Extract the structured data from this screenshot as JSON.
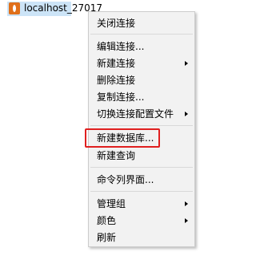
{
  "tree": {
    "connection_label": "localhost_27017",
    "icon": "mongodb-leaf-icon"
  },
  "menu": {
    "items": [
      {
        "label": "关闭连接",
        "submenu": false
      },
      {
        "label": "编辑连接...",
        "submenu": false
      },
      {
        "label": "新建连接",
        "submenu": true
      },
      {
        "label": "删除连接",
        "submenu": false
      },
      {
        "label": "复制连接...",
        "submenu": false
      },
      {
        "label": "切换连接配置文件",
        "submenu": true
      },
      {
        "label": "新建数据库...",
        "submenu": false,
        "highlighted": true
      },
      {
        "label": "新建查询",
        "submenu": false
      },
      {
        "label": "命令列界面...",
        "submenu": false
      },
      {
        "label": "管理组",
        "submenu": true
      },
      {
        "label": "颜色",
        "submenu": true
      },
      {
        "label": "刷新",
        "submenu": false
      }
    ]
  },
  "colors": {
    "selection": "#cce4f7",
    "menu_background": "#f2f2f2",
    "highlight_outline": "#e02020",
    "mongodb_icon": "#e0701a"
  }
}
